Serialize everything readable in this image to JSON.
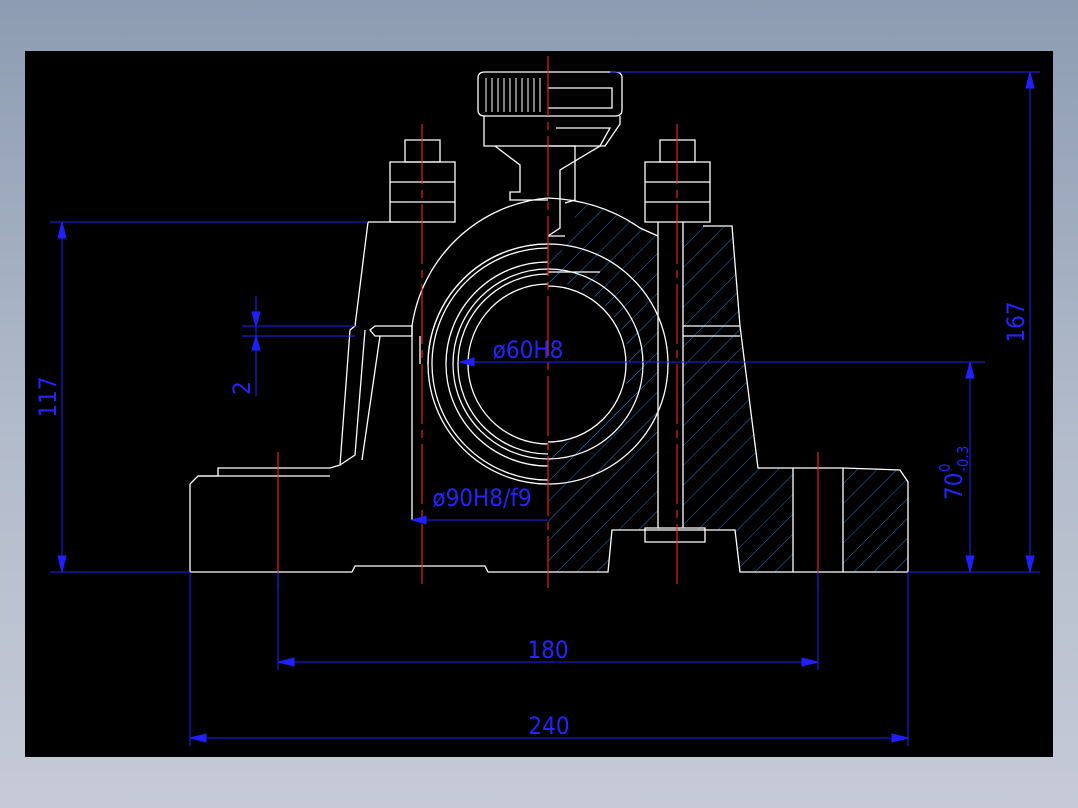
{
  "drawing": {
    "colors": {
      "background": "#000000",
      "outline": "#ffffff",
      "dimension": "#1f1fff",
      "centerline": "#ff1f1f",
      "hatch": "#1c78c8"
    },
    "dimensions": {
      "width_overall": "240",
      "bolt_spacing": "180",
      "height_overall": "167",
      "center_height": "117",
      "split_gap": "2",
      "bore": "ø60H8",
      "housing_bore": "ø90H8/f9",
      "base_to_center_main": "70",
      "base_to_center_upper_tol": "0",
      "base_to_center_lower_tol": "-0.3"
    }
  }
}
